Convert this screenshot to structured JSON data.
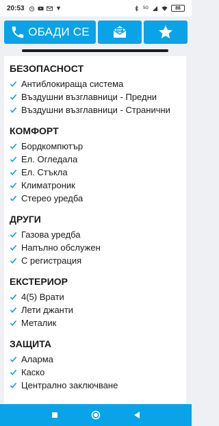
{
  "status_bar": {
    "time": "20:53",
    "battery": "86",
    "network_label": "5G"
  },
  "actions": {
    "call_label": "ОБАДИ СЕ"
  },
  "sections": [
    {
      "title": "БЕЗОПАСНОСТ",
      "items": [
        "Антиблокираща система",
        "Въздушни възглавници - Предни",
        "Въздушни възглавници - Странични"
      ]
    },
    {
      "title": "КОМФОРТ",
      "items": [
        "Бордкомпютър",
        "Ел. Огледала",
        "Ел. Стъкла",
        "Климатроник",
        "Стерео уредба"
      ]
    },
    {
      "title": "ДРУГИ",
      "items": [
        "Газова уредба",
        "Напълно обслужен",
        "С регистрация"
      ]
    },
    {
      "title": "ЕКСТЕРИОР",
      "items": [
        "4(5) Врати",
        "Лети джанти",
        "Металик"
      ]
    },
    {
      "title": "ЗАЩИТА",
      "items": [
        "Аларма",
        "Каско",
        "Централно заключване"
      ]
    }
  ],
  "colors": {
    "accent": "#0aa3e8",
    "check": "#0aa3e8"
  }
}
